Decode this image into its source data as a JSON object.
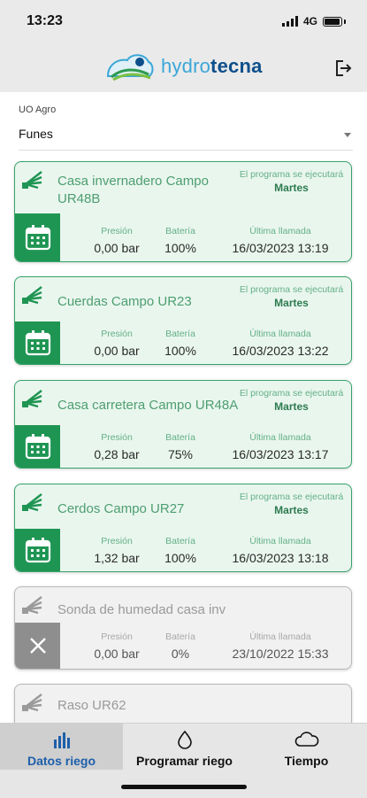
{
  "status_bar": {
    "time": "13:23",
    "network": "4G"
  },
  "header": {
    "logo_part1": "hydro",
    "logo_part2": "tecna",
    "colors": {
      "logo_light": "#3aa6d8",
      "logo_dark": "#0d4f8b"
    }
  },
  "selector": {
    "label": "UO Agro",
    "value": "Funes"
  },
  "cards": [
    {
      "title": "Casa invernadero Campo UR48B",
      "program_label": "El programa se ejecutará",
      "program_day": "Martes",
      "pressure_label": "Presión",
      "pressure": "0,00 bar",
      "battery_label": "Batería",
      "battery": "100%",
      "last_call_label": "Última llamada",
      "last_call": "16/03/2023 13:19",
      "state": "active"
    },
    {
      "title": "Cuerdas Campo UR23",
      "program_label": "El programa se ejecutará",
      "program_day": "Martes",
      "pressure_label": "Presión",
      "pressure": "0,00 bar",
      "battery_label": "Batería",
      "battery": "100%",
      "last_call_label": "Última llamada",
      "last_call": "16/03/2023 13:22",
      "state": "active"
    },
    {
      "title": "Casa carretera Campo UR48A",
      "program_label": "El programa se ejecutará",
      "program_day": "Martes",
      "pressure_label": "Presión",
      "pressure": "0,28 bar",
      "battery_label": "Batería",
      "battery": "75%",
      "last_call_label": "Última llamada",
      "last_call": "16/03/2023 13:17",
      "state": "active"
    },
    {
      "title": "Cerdos Campo UR27",
      "program_label": "El programa se ejecutará",
      "program_day": "Martes",
      "pressure_label": "Presión",
      "pressure": "1,32 bar",
      "battery_label": "Batería",
      "battery": "100%",
      "last_call_label": "Última llamada",
      "last_call": "16/03/2023 13:18",
      "state": "active"
    },
    {
      "title": "Sonda de humedad casa inv",
      "pressure_label": "Presión",
      "pressure": "0,00 bar",
      "battery_label": "Batería",
      "battery": "0%",
      "last_call_label": "Última llamada",
      "last_call": "23/10/2022 15:33",
      "state": "inactive"
    },
    {
      "title": "Raso UR62",
      "state": "inactive"
    }
  ],
  "tabs": [
    {
      "label": "Datos riego",
      "icon": "bar-chart-icon",
      "active": true
    },
    {
      "label": "Programar riego",
      "icon": "water-drop-icon",
      "active": false
    },
    {
      "label": "Tiempo",
      "icon": "cloud-icon",
      "active": false
    }
  ],
  "colors": {
    "accent": "#1f9553",
    "card_bg": "#e9f6ee",
    "inactive": "#8e8e8e",
    "tab_active": "#1d5fab"
  }
}
